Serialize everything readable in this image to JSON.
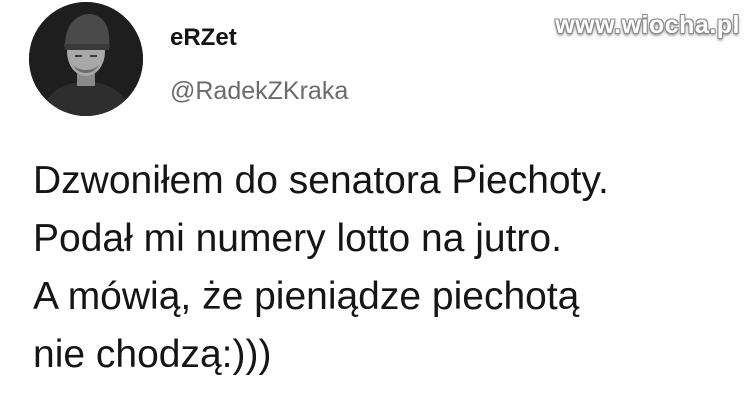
{
  "author": {
    "display_name": "eRZet",
    "handle": "@RadekZKraka",
    "avatar_icon": "profile-photo-man-in-beanie"
  },
  "watermark": {
    "text": "www.wiocha.pl"
  },
  "tweet": {
    "lines": [
      "Dzwoniłem do senatora Piechoty.",
      "Podał mi numery lotto na jutro.",
      "A mówią, że pieniądze piechotą",
      "nie chodzą:)))"
    ]
  },
  "colors": {
    "background": "#ffffff",
    "text": "#151515",
    "handle": "#6b6b6b"
  }
}
